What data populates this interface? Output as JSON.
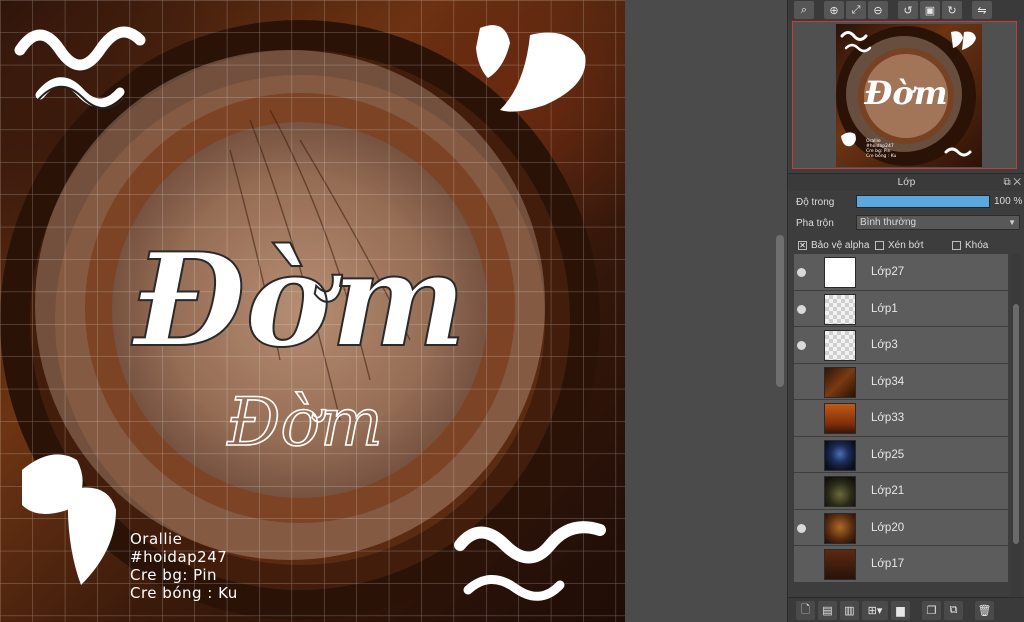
{
  "canvas": {
    "title_text": "Đờm",
    "subtitle_text": "Đờm",
    "credits": [
      "Orallie",
      "#hoidap247",
      "Cre bg: Pin",
      "Cre bóng : Ku"
    ]
  },
  "navigator": {
    "toolbar_icons": [
      "zoom-icon",
      "zoom-in-icon",
      "fit-icon",
      "zoom-out-icon",
      "rotate-left-icon",
      "fit-window-icon",
      "rotate-right-icon",
      "flip-icon"
    ],
    "thumb_title": "Đờm",
    "thumb_credits": [
      "Orallie",
      "#hoidap247",
      "Cre bg: Pin",
      "Cre bóng : Ku"
    ]
  },
  "layer_panel": {
    "title": "Lớp",
    "opacity_label": "Độ trong",
    "opacity_value": "100 %",
    "opacity_fraction": 1.0,
    "blend_label": "Pha trộn",
    "blend_value": "Bình thường",
    "checkbox_alpha": "Bảo vệ alpha",
    "checkbox_alpha_checked": true,
    "checkbox_clip": "Xén bớt",
    "checkbox_lock": "Khóa",
    "layers": [
      {
        "name": "Lớp27",
        "visible": true,
        "thumb": "white"
      },
      {
        "name": "Lớp1",
        "visible": true,
        "thumb": "checker"
      },
      {
        "name": "Lớp3",
        "visible": true,
        "thumb": "checker"
      },
      {
        "name": "Lớp34",
        "visible": false,
        "thumb": "dark-bronze"
      },
      {
        "name": "Lớp33",
        "visible": false,
        "thumb": "orange"
      },
      {
        "name": "Lớp25",
        "visible": false,
        "thumb": "blue"
      },
      {
        "name": "Lớp21",
        "visible": false,
        "thumb": "green"
      },
      {
        "name": "Lớp20",
        "visible": true,
        "thumb": "amber"
      },
      {
        "name": "Lớp17",
        "visible": false,
        "thumb": "brown"
      }
    ]
  },
  "colors": {
    "accent": "#5ba8e0",
    "panel_bg": "#3d3d3d",
    "navigator_border": "#c93b3b"
  }
}
